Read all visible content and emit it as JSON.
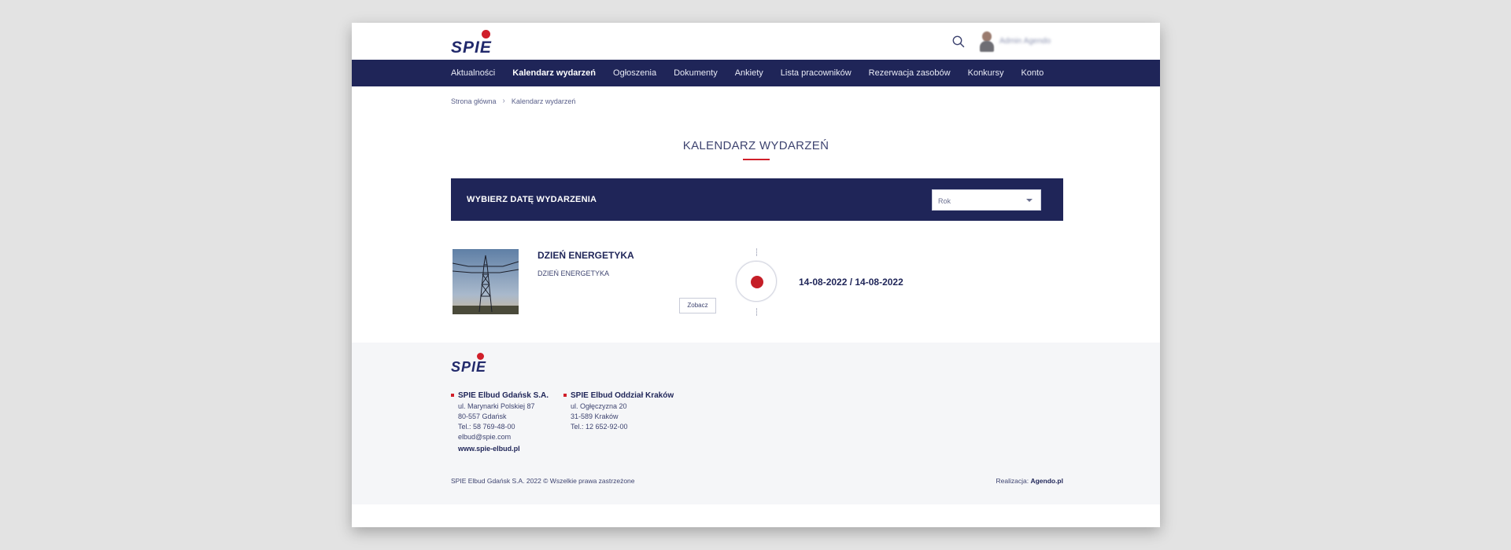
{
  "brand": {
    "name": "SPIE",
    "accent": "#d01f2a",
    "navy": "#1f2558"
  },
  "header": {
    "user_name": "Admin Agendo",
    "icons": [
      "search-icon",
      "avatar"
    ]
  },
  "nav": {
    "items": [
      {
        "label": "Aktualności"
      },
      {
        "label": "Kalendarz wydarzeń",
        "active": true
      },
      {
        "label": "Ogłoszenia"
      },
      {
        "label": "Dokumenty"
      },
      {
        "label": "Ankiety"
      },
      {
        "label": "Lista pracowników"
      },
      {
        "label": "Rezerwacja zasobów"
      },
      {
        "label": "Konkursy"
      },
      {
        "label": "Konto"
      }
    ]
  },
  "breadcrumb": {
    "home": "Strona główna",
    "current": "Kalendarz wydarzeń"
  },
  "main": {
    "title": "KALENDARZ WYDARZEŃ",
    "filter": {
      "label": "WYBIERZ DATĘ WYDARZENIA",
      "select_value": "Rok"
    },
    "event": {
      "title": "DZIEŃ ENERGETYKA",
      "description": "DZIEŃ ENERGETYKA",
      "button": "Zobacz",
      "date": "14-08-2022 / 14-08-2022"
    }
  },
  "footer": {
    "offices": [
      {
        "name": "SPIE Elbud Gdańsk S.A.",
        "lines": [
          "ul. Marynarki Polskiej 87",
          "80-557 Gdańsk",
          "Tel.: 58 769-48-00",
          "elbud@spie.com"
        ]
      },
      {
        "name": "SPIE Elbud Oddział Kraków",
        "lines": [
          "ul. Ogłęczyzna 20",
          "31-589 Kraków",
          "Tel.: 12 652-92-00"
        ]
      }
    ],
    "website": "www.spie-elbud.pl",
    "copyright": "SPIE Elbud Gdańsk S.A. 2022 © Wszelkie prawa zastrzeżone",
    "realization_label": "Realizacja: ",
    "realization_link": "Agendo.pl"
  }
}
